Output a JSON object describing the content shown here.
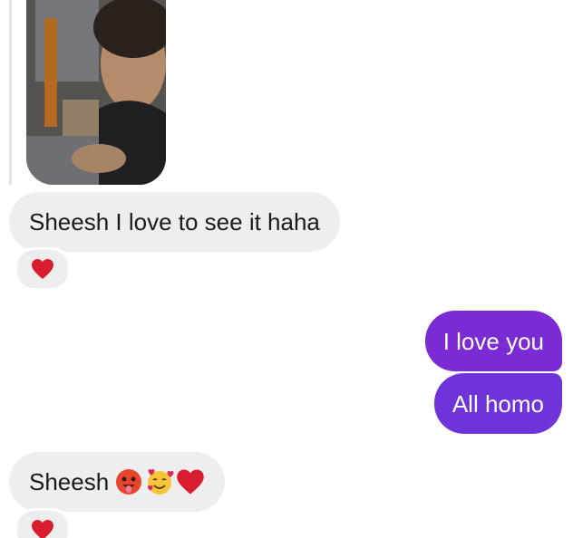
{
  "messages": [
    {
      "id": "photo",
      "type": "image",
      "direction": "incoming"
    },
    {
      "id": "m1",
      "direction": "incoming",
      "text": "Sheesh I love to see it haha",
      "reaction": "red-heart"
    },
    {
      "id": "m2",
      "direction": "outgoing",
      "text": "I love you"
    },
    {
      "id": "m3",
      "direction": "outgoing",
      "text": "All homo"
    },
    {
      "id": "m4",
      "direction": "incoming",
      "text": "Sheesh",
      "emojis": [
        "hot-face-emoji",
        "smiling-face-with-hearts-emoji",
        "red-heart-emoji"
      ],
      "reaction": "red-heart"
    }
  ],
  "colors": {
    "incoming_bubble": "#eeeeee",
    "outgoing_bubble": "#7b2fd6",
    "heart": "#d91f2f"
  }
}
